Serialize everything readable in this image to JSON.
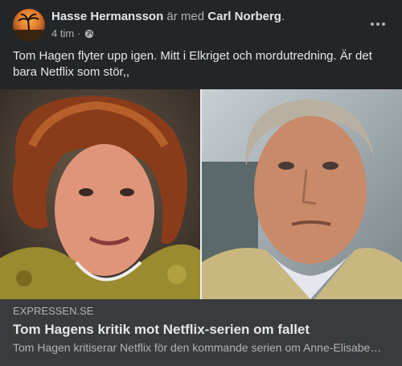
{
  "header": {
    "author": "Hasse Hermansson",
    "with_text": " är med ",
    "tagged": "Carl Norberg",
    "period": ".",
    "time": "4 tim",
    "separator": "·"
  },
  "post": {
    "text": "Tom Hagen flyter upp igen. Mitt i Elkriget och mordutredning. Är det bara Netflix som stör,,"
  },
  "link": {
    "source": "EXPRESSEN.SE",
    "title": "Tom Hagens kritik mot Netflix-serien om fallet",
    "description": "Tom Hagen kritiserar Netflix för den kommande serien om Anne-Elisabeth Hagen"
  },
  "icons": {
    "privacy": "globe-icon",
    "menu": "more-horizontal-icon"
  },
  "colors": {
    "background": "#242526",
    "link_box": "#3a3b3c",
    "primary_text": "#e4e6eb",
    "secondary_text": "#b0b3b8"
  }
}
